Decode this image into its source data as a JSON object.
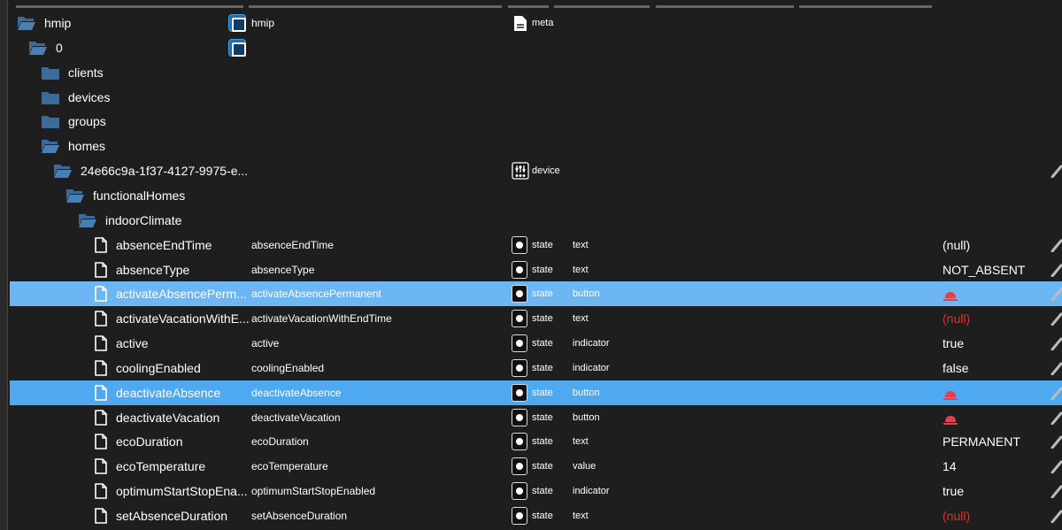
{
  "colors": {
    "folder": "#3b6b9a",
    "selected_row_1": "#6cb6f3",
    "selected_row_2": "#4ea9f0",
    "null_red": "#e03030",
    "bell_red": "#e04050"
  },
  "rows": [
    {
      "level": 0,
      "kind": "folder-open",
      "label": "hmip",
      "name": "hmip",
      "objicon": true,
      "type": "meta",
      "type_icon": "document-icon"
    },
    {
      "level": 1,
      "kind": "folder-open",
      "label": "0",
      "name": "",
      "objicon": true
    },
    {
      "level": 2,
      "kind": "folder",
      "label": "clients"
    },
    {
      "level": 2,
      "kind": "folder",
      "label": "devices"
    },
    {
      "level": 2,
      "kind": "folder",
      "label": "groups"
    },
    {
      "level": 2,
      "kind": "folder-open",
      "label": "homes"
    },
    {
      "level": 3,
      "kind": "folder-open",
      "label": "24e66c9a-1f37-4127-9975-e...",
      "type": "device",
      "type_icon": "device-icon",
      "edit": true
    },
    {
      "level": 4,
      "kind": "folder-open",
      "label": "functionalHomes"
    },
    {
      "level": 5,
      "kind": "folder-open",
      "label": "indoorClimate"
    },
    {
      "level": 6,
      "kind": "file",
      "label": "absenceEndTime",
      "name": "absenceEndTime",
      "type": "state",
      "role": "text",
      "value": "(null)",
      "edit": true
    },
    {
      "level": 6,
      "kind": "file",
      "label": "absenceType",
      "name": "absenceType",
      "type": "state",
      "role": "text",
      "value": "NOT_ABSENT",
      "edit": true
    },
    {
      "level": 6,
      "kind": "file",
      "label": "activateAbsencePerm...",
      "name": "activateAbsencePermanent",
      "type": "state",
      "role": "button",
      "bell": true,
      "edit": true,
      "selected": 1
    },
    {
      "level": 6,
      "kind": "file",
      "label": "activateVacationWithE...",
      "name": "activateVacationWithEndTime",
      "type": "state",
      "role": "text",
      "value": "(null)",
      "red": true,
      "edit": true
    },
    {
      "level": 6,
      "kind": "file",
      "label": "active",
      "name": "active",
      "type": "state",
      "role": "indicator",
      "value": "true",
      "edit": true
    },
    {
      "level": 6,
      "kind": "file",
      "label": "coolingEnabled",
      "name": "coolingEnabled",
      "type": "state",
      "role": "indicator",
      "value": "false",
      "edit": true
    },
    {
      "level": 6,
      "kind": "file",
      "label": "deactivateAbsence",
      "name": "deactivateAbsence",
      "type": "state",
      "role": "button",
      "bell": true,
      "edit": true,
      "selected": 2
    },
    {
      "level": 6,
      "kind": "file",
      "label": "deactivateVacation",
      "name": "deactivateVacation",
      "type": "state",
      "role": "button",
      "bell": true,
      "edit": true
    },
    {
      "level": 6,
      "kind": "file",
      "label": "ecoDuration",
      "name": "ecoDuration",
      "type": "state",
      "role": "text",
      "value": "PERMANENT",
      "edit": true
    },
    {
      "level": 6,
      "kind": "file",
      "label": "ecoTemperature",
      "name": "ecoTemperature",
      "type": "state",
      "role": "value",
      "value": "14",
      "edit": true
    },
    {
      "level": 6,
      "kind": "file",
      "label": "optimumStartStopEna...",
      "name": "optimumStartStopEnabled",
      "type": "state",
      "role": "indicator",
      "value": "true",
      "edit": true
    },
    {
      "level": 6,
      "kind": "file",
      "label": "setAbsenceDuration",
      "name": "setAbsenceDuration",
      "type": "state",
      "role": "text",
      "value": "(null)",
      "red": true,
      "edit": true
    }
  ]
}
